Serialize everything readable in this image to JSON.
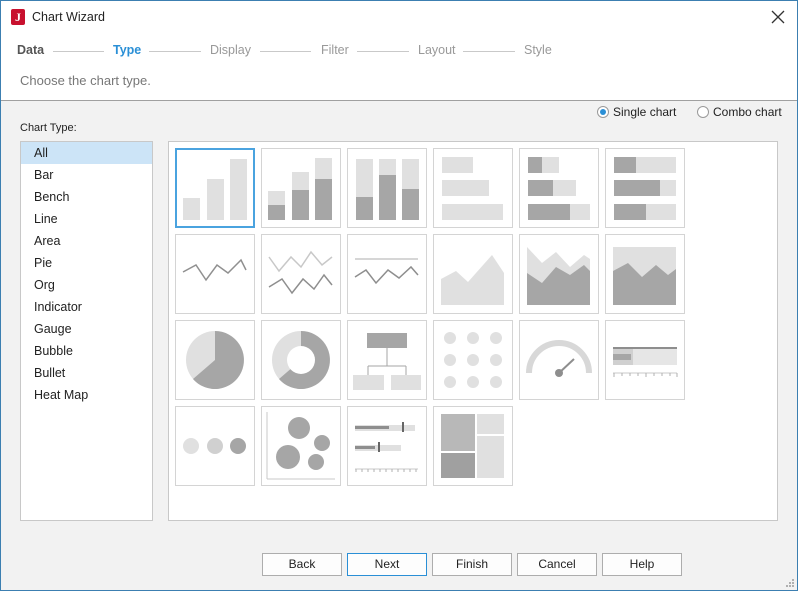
{
  "window": {
    "title": "Chart Wizard"
  },
  "steps": [
    "Data",
    "Type",
    "Display",
    "Filter",
    "Layout",
    "Style"
  ],
  "subtitle": "Choose the chart type.",
  "mode": {
    "single_label": "Single chart",
    "combo_label": "Combo chart",
    "selected": "single"
  },
  "chart_type_label": "Chart Type:",
  "chart_types": [
    "All",
    "Bar",
    "Bench",
    "Line",
    "Area",
    "Pie",
    "Org",
    "Indicator",
    "Gauge",
    "Bubble",
    "Bullet",
    "Heat Map"
  ],
  "selected_type": "All",
  "thumbnails": [
    "bar-clustered-icon",
    "bar-stacked-icon",
    "bar-stacked-percent-icon",
    "bench-horizontal-icon",
    "bench-stacked-icon",
    "bench-stacked-percent-icon",
    "line-icon",
    "line-multi-icon",
    "line-target-icon",
    "area-icon",
    "area-stacked-icon",
    "area-stacked-percent-icon",
    "pie-icon",
    "donut-icon",
    "org-chart-icon",
    "indicator-dots-icon",
    "gauge-icon",
    "bullet-horizontal-icon",
    "bubble-row-icon",
    "bubble-scatter-icon",
    "bullet-bars-icon",
    "heat-map-icon"
  ],
  "buttons": {
    "back": "Back",
    "next": "Next",
    "finish": "Finish",
    "cancel": "Cancel",
    "help": "Help"
  },
  "colors": {
    "accent": "#2a8fd6",
    "selection": "#cce4f7",
    "brand": "#c8102e"
  }
}
